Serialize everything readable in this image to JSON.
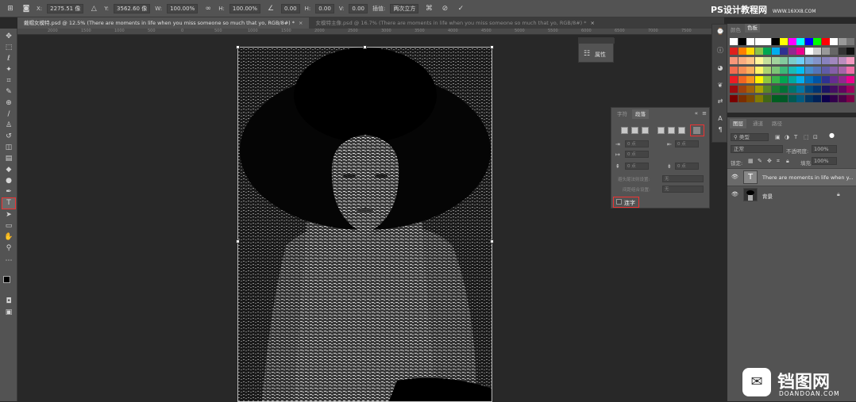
{
  "options_bar": {
    "x_label": "X:",
    "x_value": "2275.51 像",
    "y_label": "Y:",
    "y_value": "3562.60 像",
    "w_label": "W:",
    "w_value": "100.00%",
    "h_label": "H:",
    "h_value": "100.00%",
    "angle_value": "0.00",
    "h2_label": "H:",
    "h2_value": "0.00",
    "v_label": "V:",
    "v_value": "0.00",
    "interp_label": "插值:",
    "interp_value": "两次立方"
  },
  "watermark_top": "PS设计教程网",
  "watermark_top_url": "WWW.16XX8.COM",
  "tabs": [
    {
      "label": "戴帽女模特.psd @ 12.5% (There are moments in life when you miss someone so much that yo, RGB/8#) *",
      "close": "×"
    },
    {
      "label": "女模特主像.psd @ 16.7% (There are moments in life when you miss someone so much that yo, RGB/8#) *",
      "close": "×"
    }
  ],
  "ruler_ticks": [
    "2000",
    "1500",
    "1000",
    "500",
    "0",
    "500",
    "1000",
    "1500",
    "2000",
    "2500",
    "3000",
    "3500",
    "4000",
    "4500",
    "5000",
    "5500",
    "6000",
    "6500",
    "7000",
    "7500",
    "8000"
  ],
  "props_panel": {
    "label": "属性"
  },
  "para_panel": {
    "tab_char": "字符",
    "tab_para": "段落",
    "field1": "0 点",
    "field2": "0 点",
    "field3": "0 点",
    "field4": "0 点",
    "field5": "0 点",
    "label_before": "避头尾法则设置:",
    "value_before": "无",
    "label_after": "间距组合设置:",
    "value_after": "无",
    "hyphen_label": "连字"
  },
  "layers_panel": {
    "tab_layers": "图层",
    "tab_channels": "通道",
    "tab_paths": "路径",
    "kind_label": "类型",
    "blend_mode": "正常",
    "opacity_label": "不透明度:",
    "opacity_value": "100%",
    "lock_label": "锁定:",
    "fill_label": "填充:",
    "fill_value": "100%",
    "layers": [
      {
        "name": "There are moments in life when y...",
        "type": "text"
      },
      {
        "name": "背景",
        "type": "image"
      }
    ]
  },
  "swatches_tabs": {
    "tab1": "颜色",
    "tab2": "色板"
  },
  "swatch_colors": [
    [
      "#ffffff",
      "#000000",
      "#ffffff",
      "#ffffff",
      "#ffffff",
      "#000000",
      "#ffff00",
      "#ff00ff",
      "#00ffff",
      "#0000ff",
      "#00ff00",
      "#ff0000",
      "#ffffff",
      "#999999",
      "#777777"
    ],
    [
      "#e0201c",
      "#ff7e00",
      "#ffd800",
      "#8bc34a",
      "#00a651",
      "#00aeef",
      "#2e3192",
      "#92278f",
      "#ec008c",
      "#ffffff",
      "#cccccc",
      "#999999",
      "#666666",
      "#333333",
      "#111111"
    ],
    [
      "#f7977a",
      "#f9ad81",
      "#fdc68a",
      "#fff79a",
      "#c4df9b",
      "#a2d39c",
      "#82ca9d",
      "#7bcdc8",
      "#6ecff6",
      "#7ea7d8",
      "#8493ca",
      "#8882be",
      "#a187be",
      "#bc8dbf",
      "#f49ac2"
    ],
    [
      "#f26c4f",
      "#f68e55",
      "#fbaf5c",
      "#fff467",
      "#acd372",
      "#7cc576",
      "#3bb878",
      "#1abbb4",
      "#00bff3",
      "#438ccb",
      "#5574b9",
      "#605ca8",
      "#855fa8",
      "#a763a8",
      "#f06ea9"
    ],
    [
      "#ed1c24",
      "#f26522",
      "#f7941d",
      "#fff200",
      "#8dc73f",
      "#39b54a",
      "#00a651",
      "#00a99d",
      "#00aeef",
      "#0072bc",
      "#0054a6",
      "#2e3192",
      "#662d91",
      "#92278f",
      "#ec008c"
    ],
    [
      "#9e0b0f",
      "#a0410d",
      "#a36209",
      "#aba000",
      "#598527",
      "#1a7b30",
      "#007236",
      "#00746b",
      "#0076a3",
      "#004b80",
      "#003471",
      "#1b1464",
      "#440e62",
      "#630460",
      "#9e005d"
    ],
    [
      "#790000",
      "#7b2e00",
      "#7d4900",
      "#827b00",
      "#406618",
      "#005e20",
      "#005826",
      "#005952",
      "#005b7f",
      "#003663",
      "#002157",
      "#0d004c",
      "#32004b",
      "#4b0049",
      "#7b0046"
    ]
  ],
  "site_watermark": {
    "brand": "铛图网",
    "url": "DOANDOAN.COM"
  }
}
